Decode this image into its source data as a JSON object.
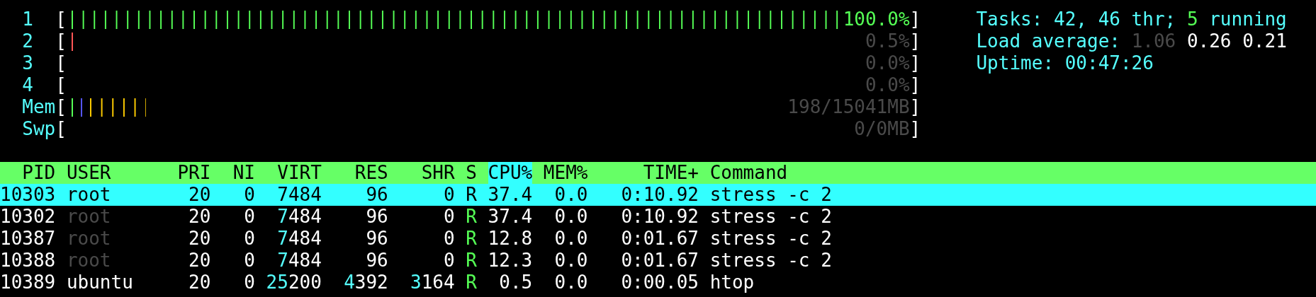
{
  "meters": [
    {
      "label": "1",
      "open": "[",
      "close": "]",
      "value": "100.0%",
      "segments": [
        {
          "color": "#55ff55",
          "level": 1.0
        }
      ]
    },
    {
      "label": "2",
      "open": "[",
      "close": "]",
      "value": "0.5%",
      "segments": [
        {
          "color": "#ff5555",
          "level": 0.005
        }
      ]
    },
    {
      "label": "3",
      "open": "[",
      "close": "]",
      "value": "0.0%"
    },
    {
      "label": "4",
      "open": "[",
      "close": "]",
      "value": "0.0%"
    },
    {
      "label": "Mem",
      "open": "[",
      "close": "]",
      "value": "198/15041MB",
      "segments": [
        {
          "color": "#55ff55",
          "level": 0.013
        },
        {
          "color": "#5555ff",
          "level": 0.013
        },
        {
          "color": "#ffcc00",
          "level": 0.078
        }
      ]
    },
    {
      "label": "Swp",
      "open": "[",
      "close": "]",
      "value": "0/0MB"
    }
  ],
  "info": [
    {
      "parts": [
        {
          "text": "Tasks: 42, 46 thr; ",
          "kind": "label"
        },
        {
          "text": "5",
          "kind": "running"
        },
        {
          "text": " running",
          "kind": "label"
        }
      ]
    },
    {
      "parts": [
        {
          "text": "Load average: ",
          "kind": "label"
        },
        {
          "text": "1.06",
          "kind": "dim"
        },
        {
          "text": " 0.26 0.21",
          "kind": "bright"
        }
      ]
    },
    {
      "parts": [
        {
          "text": "Uptime: 00:47:26",
          "kind": "label"
        }
      ]
    }
  ],
  "columns": [
    {
      "label": "PID",
      "sorted": false
    },
    {
      "label": "USER",
      "sorted": false
    },
    {
      "label": "PRI",
      "sorted": false
    },
    {
      "label": "NI",
      "sorted": false
    },
    {
      "label": "VIRT",
      "sorted": false
    },
    {
      "label": "RES",
      "sorted": false
    },
    {
      "label": "SHR",
      "sorted": false
    },
    {
      "label": "S",
      "sorted": false
    },
    {
      "label": "CPU%",
      "sorted": true
    },
    {
      "label": "MEM%",
      "sorted": false
    },
    {
      "label": "TIME+",
      "sorted": false
    },
    {
      "label": "Command",
      "sorted": false
    }
  ],
  "rows": [
    {
      "selected": true,
      "user_dimmed": false,
      "cells": [
        "10303",
        "root",
        "20",
        "0",
        "7484",
        "96",
        "0",
        "R",
        "37.4",
        "0.0",
        "0:10.92",
        "stress -c 2"
      ]
    },
    {
      "selected": false,
      "user_dimmed": true,
      "cells": [
        "10302",
        "root",
        "20",
        "0",
        "7484",
        "96",
        "0",
        "R",
        "37.4",
        "0.0",
        "0:10.92",
        "stress -c 2"
      ]
    },
    {
      "selected": false,
      "user_dimmed": true,
      "cells": [
        "10387",
        "root",
        "20",
        "0",
        "7484",
        "96",
        "0",
        "R",
        "12.8",
        "0.0",
        "0:01.67",
        "stress -c 2"
      ]
    },
    {
      "selected": false,
      "user_dimmed": true,
      "cells": [
        "10388",
        "root",
        "20",
        "0",
        "7484",
        "96",
        "0",
        "R",
        "12.3",
        "0.0",
        "0:01.67",
        "stress -c 2"
      ]
    },
    {
      "selected": false,
      "user_dimmed": false,
      "cells": [
        "10389",
        "ubuntu",
        "20",
        "0",
        "25200",
        "4392",
        "3164",
        "R",
        "0.5",
        "0.0",
        "0:00.05",
        "htop"
      ]
    }
  ]
}
